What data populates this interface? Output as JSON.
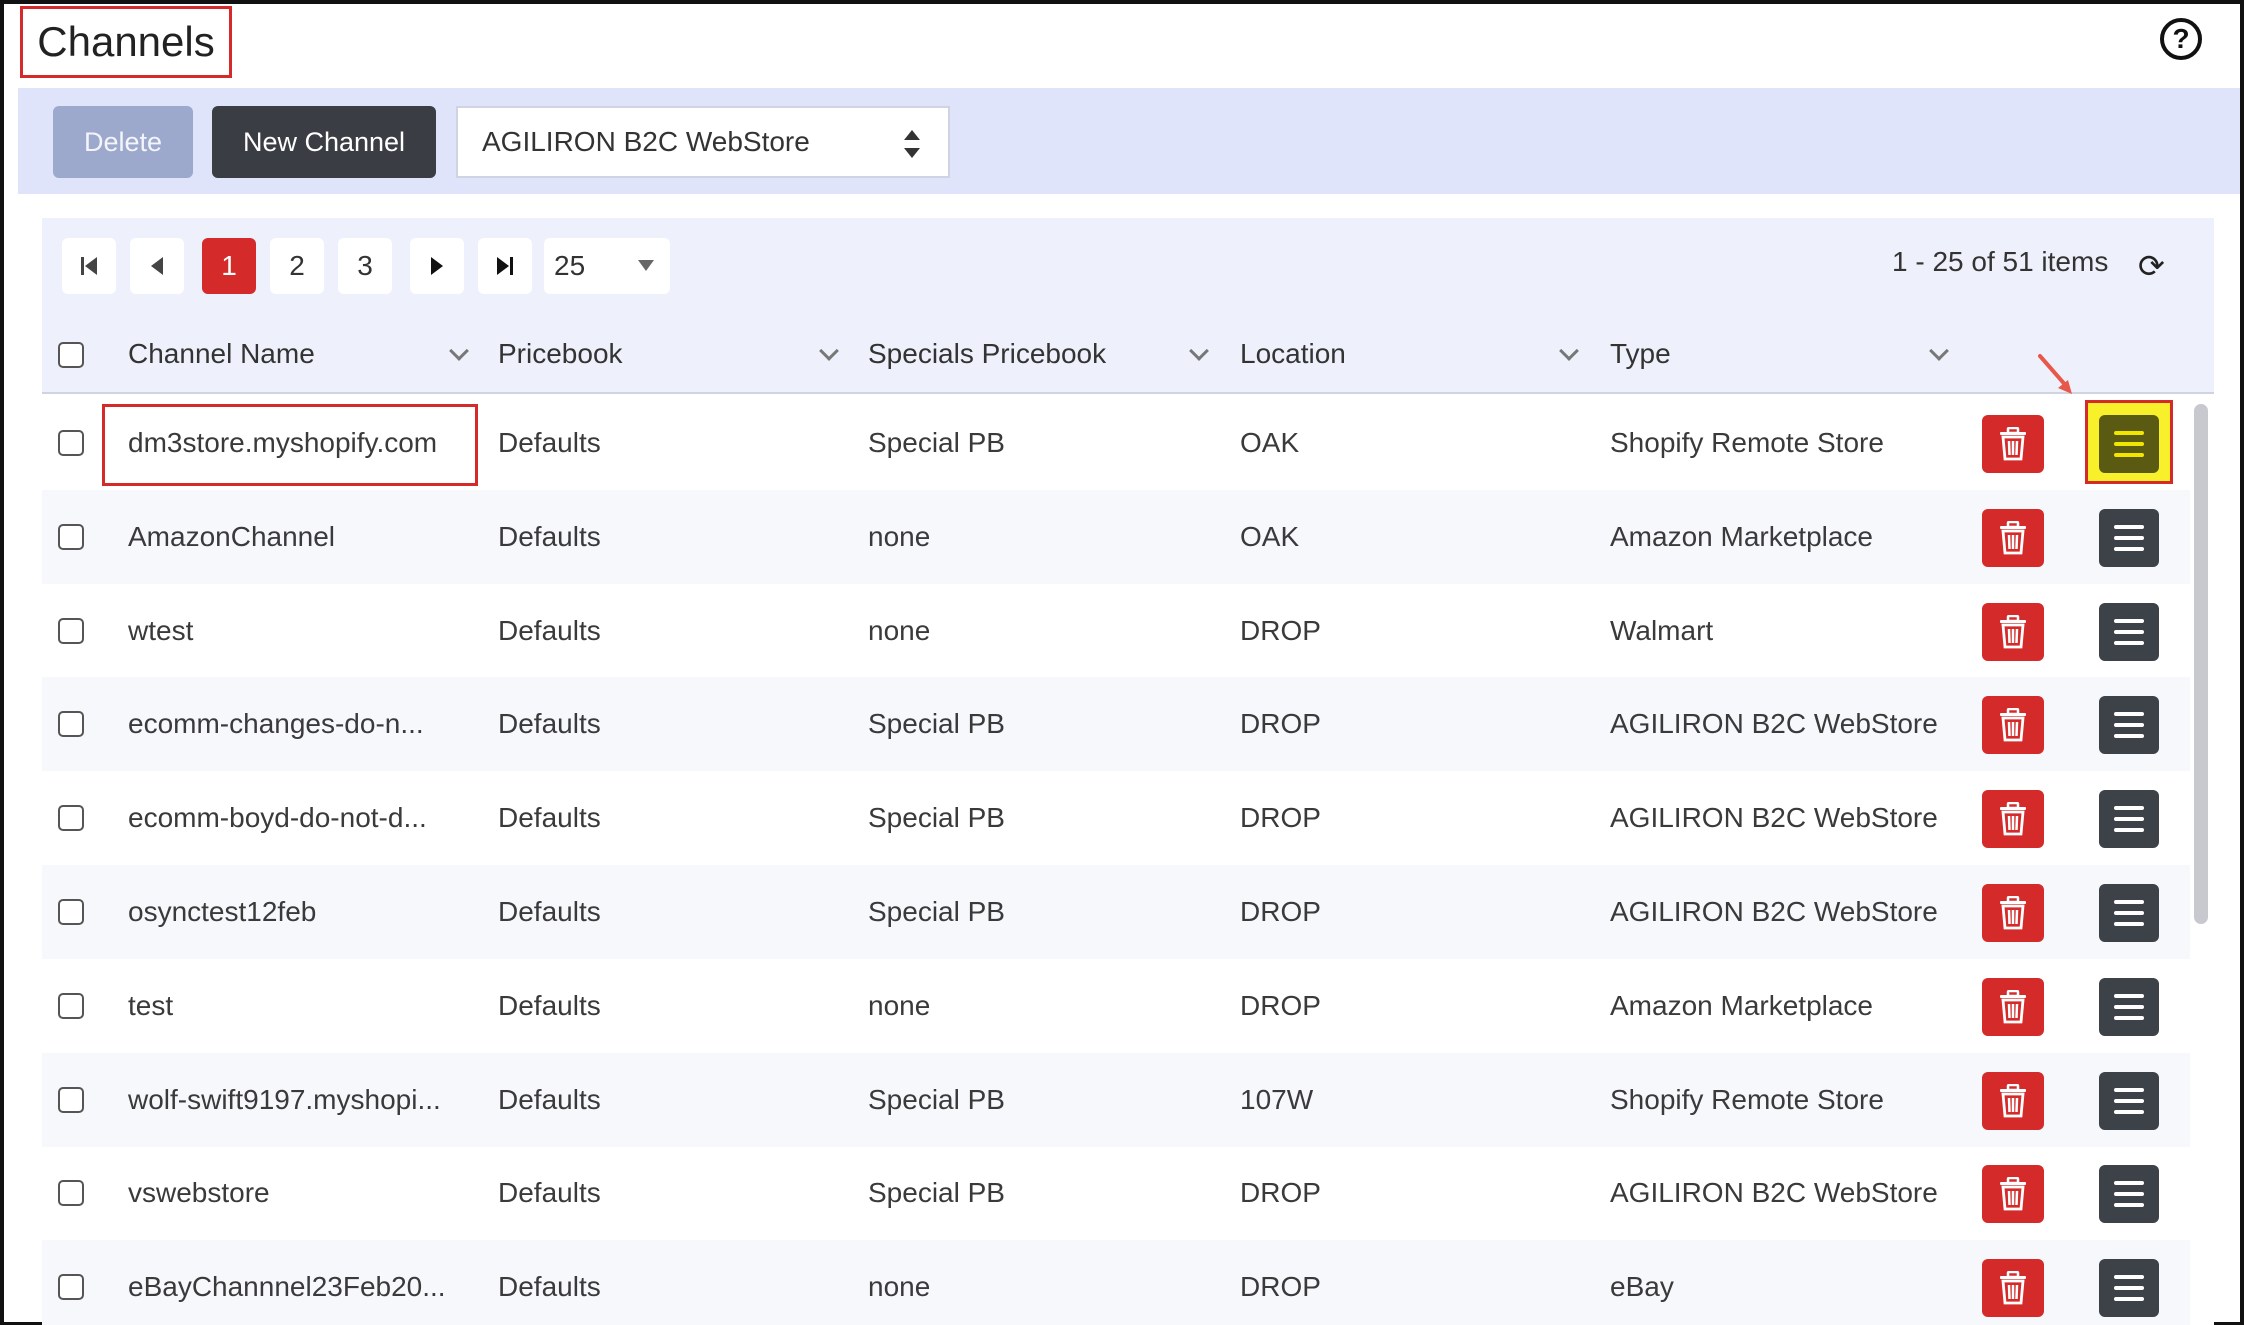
{
  "page": {
    "title": "Channels",
    "help_icon": "help-circle-icon"
  },
  "toolbar": {
    "delete_label": "Delete",
    "new_label": "New Channel",
    "channel_select_value": "AGILIRON B2C WebStore"
  },
  "pager": {
    "pages": [
      "1",
      "2",
      "3"
    ],
    "current_page": "1",
    "page_size": "25",
    "items_info": "1 - 25 of 51 items"
  },
  "columns": [
    "Channel Name",
    "Pricebook",
    "Specials Pricebook",
    "Location",
    "Type"
  ],
  "rows": [
    {
      "name": "dm3store.myshopify.com",
      "pricebook": "Defaults",
      "specials": "Special PB",
      "location": "OAK",
      "type": "Shopify Remote Store"
    },
    {
      "name": "AmazonChannel",
      "pricebook": "Defaults",
      "specials": "none",
      "location": "OAK",
      "type": "Amazon Marketplace"
    },
    {
      "name": "wtest",
      "pricebook": "Defaults",
      "specials": "none",
      "location": "DROP",
      "type": "Walmart"
    },
    {
      "name": "ecomm-changes-do-n...",
      "pricebook": "Defaults",
      "specials": "Special PB",
      "location": "DROP",
      "type": "AGILIRON B2C WebStore"
    },
    {
      "name": "ecomm-boyd-do-not-d...",
      "pricebook": "Defaults",
      "specials": "Special PB",
      "location": "DROP",
      "type": "AGILIRON B2C WebStore"
    },
    {
      "name": "osynctest12feb",
      "pricebook": "Defaults",
      "specials": "Special PB",
      "location": "DROP",
      "type": "AGILIRON B2C WebStore"
    },
    {
      "name": "test",
      "pricebook": "Defaults",
      "specials": "none",
      "location": "DROP",
      "type": "Amazon Marketplace"
    },
    {
      "name": "wolf-swift9197.myshopi...",
      "pricebook": "Defaults",
      "specials": "Special PB",
      "location": "107W",
      "type": "Shopify Remote Store"
    },
    {
      "name": "vswebstore",
      "pricebook": "Defaults",
      "specials": "Special PB",
      "location": "DROP",
      "type": "AGILIRON B2C WebStore"
    },
    {
      "name": "eBayChannnel23Feb20...",
      "pricebook": "Defaults",
      "specials": "none",
      "location": "DROP",
      "type": "eBay"
    }
  ],
  "colors": {
    "accent_red": "#d42a2a",
    "toolbar_bg": "#dfe4fb",
    "highlight_yellow": "#f7f02a"
  }
}
